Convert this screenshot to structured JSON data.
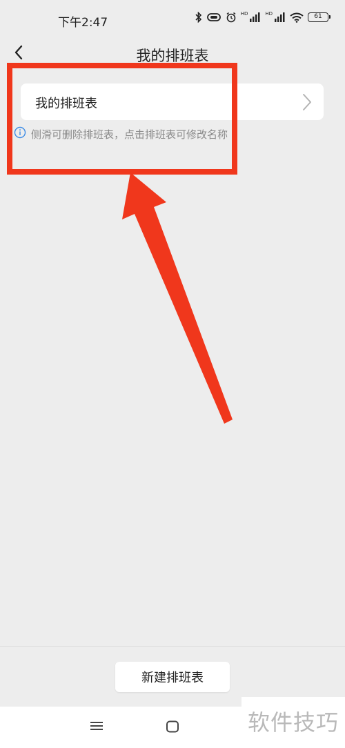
{
  "status_bar": {
    "time": "下午2:47",
    "hd_label_1": "HD",
    "hd_label_2": "HD",
    "battery_level": "61",
    "icons": [
      "bluetooth-icon",
      "vibrate-icon",
      "alarm-icon",
      "signal-icon",
      "signal-icon",
      "wifi-icon",
      "battery-icon"
    ]
  },
  "header": {
    "title": "我的排班表",
    "back_icon": "chevron-left-icon"
  },
  "schedule_list": {
    "items": [
      {
        "label": "我的排班表",
        "icon": "chevron-right-icon"
      }
    ]
  },
  "hint": {
    "icon": "info-icon",
    "text": "侧滑可删除排班表，点击排班表可修改名称"
  },
  "annotation": {
    "highlight_color": "#f0371c"
  },
  "bottom": {
    "new_button_label": "新建排班表"
  },
  "nav_bar": {
    "menu_icon": "menu-icon",
    "home_icon": "home-square-icon"
  },
  "watermark": {
    "text": "软件技巧"
  },
  "colors": {
    "background": "#ededed",
    "card": "#ffffff",
    "accent_blue": "#3b8be6",
    "hint_gray": "#8a8a8a"
  }
}
